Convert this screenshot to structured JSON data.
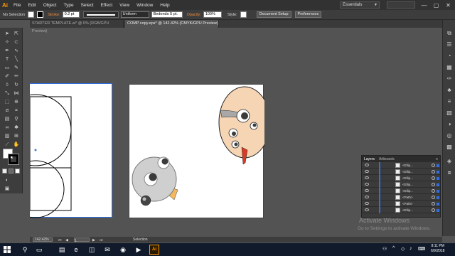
{
  "menubar": {
    "logo": "Ai",
    "items": [
      "File",
      "Edit",
      "Object",
      "Type",
      "Select",
      "Effect",
      "View",
      "Window",
      "Help"
    ],
    "workspace": "Essentials",
    "window_controls": [
      "—",
      "▢",
      "✕"
    ]
  },
  "controlbar": {
    "selection_state": "No Selection",
    "stroke_label": "Stroke:",
    "stroke_weight": "0.2 pt",
    "profile": "Uniform",
    "brush": "Bedondo 5 pt.",
    "opacity_label": "Opacity:",
    "opacity_value": "100%",
    "style_label": "Style:",
    "document_setup": "Document Setup",
    "preferences": "Preferences"
  },
  "tabs": [
    {
      "label": "STARTER TEMPLATE.ai* @ 6% (RGB/GPU Preview)",
      "active": false
    },
    {
      "label": "COMP copy.eps* @ 142.42% (CMYK/GPU Preview)",
      "active": true
    }
  ],
  "tools": [
    "selection-tool",
    "direct-selection-tool",
    "magic-wand-tool",
    "lasso-tool",
    "pen-tool",
    "curvature-tool",
    "type-tool",
    "line-tool",
    "rectangle-tool",
    "paintbrush-tool",
    "shaper-tool",
    "pencil-tool",
    "eraser-tool",
    "rotate-tool",
    "scale-tool",
    "width-tool",
    "free-transform-tool",
    "shape-builder-tool",
    "perspective-grid-tool",
    "mesh-tool",
    "gradient-tool",
    "eyedropper-tool",
    "blend-tool",
    "symbol-sprayer-tool",
    "column-graph-tool",
    "artboard-tool",
    "slice-tool",
    "hand-tool",
    "zoom-tool"
  ],
  "layers_panel": {
    "tabs": [
      "Layers",
      "Artboards"
    ],
    "rows": [
      "<Ellip...",
      "<Ellip...",
      "<Ellip...",
      "<Ellip...",
      "<Ellip...",
      "<Path>",
      "<Path>",
      "<Ellip..."
    ]
  },
  "watermark": {
    "title": "Activate Windows",
    "subtitle": "Go to Settings to activate Windows."
  },
  "statusbar": {
    "zoom": "142.42%",
    "artboard_number": "1",
    "current_tool": "Selection"
  },
  "taskbar": {
    "time": "8:11 PM",
    "date": "6/9/2018",
    "ai_label": "Ai"
  }
}
